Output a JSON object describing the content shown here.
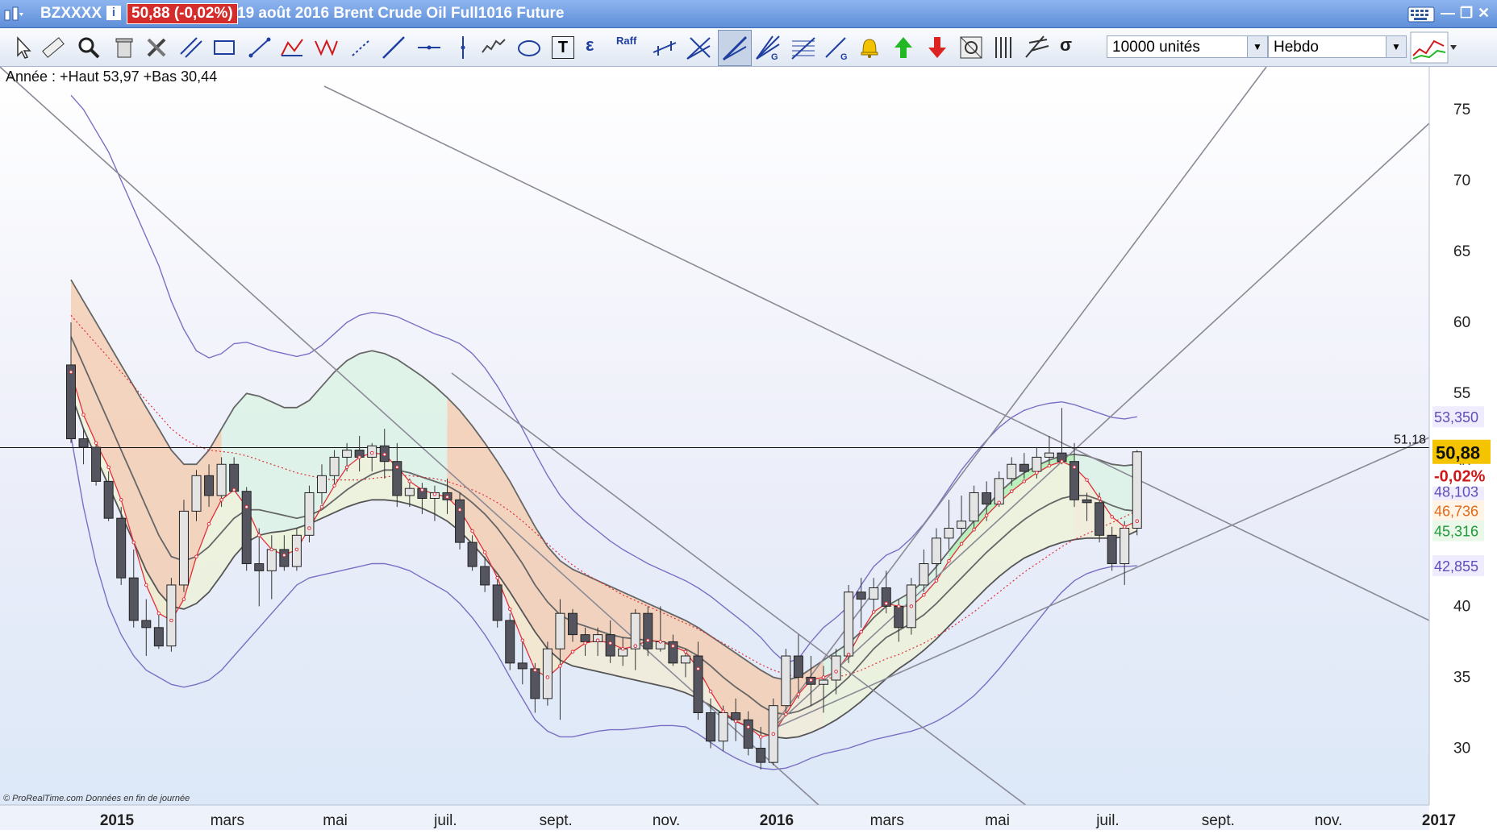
{
  "titlebar": {
    "symbol": "BZXXXX",
    "info": "i",
    "price_badge": "50,88 (-0,02%)",
    "description": "19 août 2016 Brent Crude Oil Full1016 Future"
  },
  "toolbar": {
    "quantity": "10000 unités",
    "period": "Hebdo",
    "tool_text": "T",
    "tool_epsilon": "ε",
    "tool_raff": "Raff",
    "tool_sigma": "σ",
    "tool_g": "G"
  },
  "chart_info": "Année : +Haut 53,97 +Bas 30,44",
  "copyright": "© ProRealTime.com  Données en fin de journée",
  "price_labels": {
    "hline_value": "51,18",
    "last_price": "50,88",
    "change_pct": "-0,02%",
    "bb_upper": "53,350",
    "bb_mid": "48,103",
    "ma_a": "46,736",
    "ma_b": "45,316",
    "bb_lower": "42,855"
  },
  "colors": {
    "bullish": "#e4e4e4",
    "bearish": "#555560",
    "ma_red": "#e0303a",
    "band_purple": "#7a6fc4",
    "last_price_bg": "#f5c400",
    "change_color": "#d01818"
  },
  "chart_data": {
    "type": "candlestick",
    "title": "19 août 2016 Brent Crude Oil Full1016 Future",
    "period": "Hebdo",
    "ylim": [
      26,
      78
    ],
    "yticks": [
      30,
      35,
      40,
      45,
      50,
      55,
      60,
      65,
      70,
      75
    ],
    "x_labels": [
      "2015",
      "mars",
      "mai",
      "juil.",
      "sept.",
      "nov.",
      "2016",
      "mars",
      "mai",
      "juil.",
      "sept.",
      "nov.",
      "2017"
    ],
    "x_label_positions": [
      0,
      8.8,
      17.4,
      26.2,
      35,
      43.8,
      52.6,
      61.4,
      70.2,
      79,
      87.8,
      96.6,
      105.4
    ],
    "horizontal_line": 51.18,
    "annual_high": 53.97,
    "annual_low": 30.44,
    "candles": [
      [
        57.0,
        60.0,
        51.5,
        51.8
      ],
      [
        51.8,
        52.5,
        50.0,
        51.2
      ],
      [
        51.2,
        51.5,
        48.5,
        48.8
      ],
      [
        48.8,
        49.5,
        46.0,
        46.2
      ],
      [
        46.2,
        47.0,
        41.5,
        42.0
      ],
      [
        42.0,
        44.0,
        38.5,
        39.0
      ],
      [
        39.0,
        40.5,
        36.5,
        38.5
      ],
      [
        38.5,
        39.5,
        37.0,
        37.2
      ],
      [
        37.2,
        42.0,
        36.8,
        41.5
      ],
      [
        41.5,
        47.5,
        41.0,
        46.7
      ],
      [
        46.7,
        49.6,
        46.0,
        49.2
      ],
      [
        49.2,
        50.0,
        47.0,
        47.8
      ],
      [
        47.8,
        50.5,
        47.0,
        50.0
      ],
      [
        50.0,
        50.5,
        48.5,
        48.1
      ],
      [
        48.1,
        48.4,
        42.5,
        43.0
      ],
      [
        43.0,
        45.5,
        40.0,
        42.5
      ],
      [
        42.5,
        45.0,
        40.5,
        44.0
      ],
      [
        44.0,
        45.0,
        42.5,
        42.8
      ],
      [
        42.8,
        45.5,
        42.5,
        45.0
      ],
      [
        45.0,
        48.5,
        44.5,
        48.0
      ],
      [
        48.0,
        50.0,
        47.2,
        49.2
      ],
      [
        49.2,
        51.0,
        48.5,
        50.5
      ],
      [
        50.5,
        51.5,
        49.5,
        51.0
      ],
      [
        51.0,
        52.0,
        49.5,
        50.5
      ],
      [
        50.5,
        51.5,
        49.5,
        51.3
      ],
      [
        51.3,
        52.5,
        49.0,
        50.2
      ],
      [
        50.2,
        51.5,
        47.0,
        47.8
      ],
      [
        47.8,
        49.0,
        47.0,
        48.3
      ],
      [
        48.3,
        48.7,
        46.5,
        47.6
      ],
      [
        47.6,
        48.5,
        46.0,
        48.0
      ],
      [
        48.0,
        49.0,
        46.5,
        47.5
      ],
      [
        47.5,
        48.0,
        44.0,
        44.5
      ],
      [
        44.5,
        45.0,
        42.5,
        42.8
      ],
      [
        42.8,
        43.5,
        41.0,
        41.5
      ],
      [
        41.5,
        42.0,
        38.5,
        39.0
      ],
      [
        39.0,
        39.5,
        35.5,
        36.0
      ],
      [
        36.0,
        37.5,
        34.5,
        35.6
      ],
      [
        35.6,
        36.0,
        32.5,
        33.5
      ],
      [
        33.5,
        37.5,
        33.0,
        37.0
      ],
      [
        37.0,
        40.5,
        32.0,
        39.5
      ],
      [
        39.5,
        39.8,
        37.5,
        38.0
      ],
      [
        38.0,
        38.5,
        36.5,
        37.5
      ],
      [
        37.5,
        38.5,
        36.5,
        38.0
      ],
      [
        38.0,
        39.0,
        36.0,
        36.5
      ],
      [
        36.5,
        37.8,
        35.8,
        37.0
      ],
      [
        37.0,
        39.8,
        35.5,
        39.5
      ],
      [
        39.5,
        40.0,
        36.5,
        37.0
      ],
      [
        37.0,
        40.0,
        36.8,
        37.5
      ],
      [
        37.5,
        38.0,
        35.8,
        36.0
      ],
      [
        36.0,
        37.0,
        35.0,
        36.5
      ],
      [
        36.5,
        37.5,
        32.0,
        32.5
      ],
      [
        32.5,
        33.5,
        30.0,
        30.5
      ],
      [
        30.5,
        33.0,
        29.8,
        32.5
      ],
      [
        32.5,
        33.5,
        30.5,
        32.0
      ],
      [
        32.0,
        32.6,
        29.5,
        30.0
      ],
      [
        30.0,
        31.5,
        28.5,
        29.0
      ],
      [
        29.0,
        33.5,
        28.8,
        33.0
      ],
      [
        33.0,
        37.0,
        32.5,
        36.5
      ],
      [
        36.5,
        38.0,
        33.5,
        35.0
      ],
      [
        35.0,
        36.5,
        33.0,
        34.5
      ],
      [
        34.5,
        35.8,
        32.5,
        34.8
      ],
      [
        34.8,
        37.0,
        33.8,
        36.5
      ],
      [
        36.5,
        41.5,
        36.0,
        41.0
      ],
      [
        41.0,
        42.0,
        38.5,
        40.5
      ],
      [
        40.5,
        42.0,
        39.5,
        41.3
      ],
      [
        41.3,
        42.5,
        39.5,
        40.0
      ],
      [
        40.0,
        40.5,
        37.5,
        38.5
      ],
      [
        38.5,
        42.0,
        38.0,
        41.5
      ],
      [
        41.5,
        44.0,
        41.0,
        43.0
      ],
      [
        43.0,
        45.5,
        42.0,
        44.8
      ],
      [
        44.8,
        47.5,
        44.0,
        45.5
      ],
      [
        45.5,
        47.8,
        45.0,
        46.0
      ],
      [
        46.0,
        48.5,
        45.5,
        48.0
      ],
      [
        48.0,
        48.8,
        46.0,
        47.2
      ],
      [
        47.2,
        49.5,
        47.0,
        49.0
      ],
      [
        49.0,
        50.5,
        48.5,
        50.0
      ],
      [
        50.0,
        50.8,
        49.0,
        49.5
      ],
      [
        49.5,
        51.2,
        49.0,
        50.5
      ],
      [
        50.5,
        52.0,
        50.0,
        50.8
      ],
      [
        50.8,
        53.97,
        50.0,
        50.2
      ],
      [
        50.2,
        51.5,
        47.0,
        47.5
      ],
      [
        47.5,
        48.0,
        46.0,
        47.3
      ],
      [
        47.3,
        48.0,
        44.5,
        45.0
      ],
      [
        45.0,
        45.6,
        42.5,
        43.0
      ],
      [
        43.0,
        46.0,
        41.5,
        45.5
      ],
      [
        45.5,
        51.0,
        45.0,
        50.88
      ]
    ],
    "series": [
      {
        "name": "MA fast",
        "values": [
          56.5,
          53.5,
          51.5,
          49.8,
          47.5,
          44.5,
          41.5,
          39.5,
          39.0,
          40.5,
          43.5,
          45.8,
          47.5,
          48.2,
          47.0,
          45.0,
          44.0,
          43.6,
          44.0,
          45.5,
          47.0,
          48.5,
          49.8,
          50.5,
          50.8,
          50.7,
          49.8,
          48.8,
          48.2,
          47.9,
          47.7,
          46.8,
          45.3,
          43.8,
          42.0,
          39.8,
          37.6,
          35.5,
          35.0,
          35.8,
          36.8,
          37.4,
          37.6,
          37.4,
          37.0,
          37.2,
          37.6,
          37.5,
          37.2,
          36.8,
          35.6,
          34.0,
          32.6,
          31.9,
          31.5,
          30.8,
          31.0,
          32.4,
          33.8,
          34.8,
          35.0,
          35.4,
          36.6,
          38.2,
          39.6,
          40.2,
          40.0,
          40.0,
          40.8,
          41.8,
          43.2,
          44.4,
          45.4,
          46.4,
          47.3,
          48.1,
          48.8,
          49.4,
          49.9,
          50.2,
          49.8,
          48.9,
          47.6,
          46.3,
          45.6,
          46.0
        ]
      },
      {
        "name": "MA mid",
        "values": [
          59.0,
          57.0,
          55.0,
          53.0,
          51.0,
          49.0,
          47.0,
          45.0,
          43.5,
          43.2,
          43.5,
          44.2,
          45.2,
          46.2,
          46.8,
          46.8,
          46.6,
          46.4,
          46.2,
          46.4,
          46.8,
          47.5,
          48.2,
          48.8,
          49.3,
          49.6,
          49.6,
          49.4,
          49.1,
          48.8,
          48.5,
          48.0,
          47.3,
          46.5,
          45.5,
          44.3,
          43.0,
          41.5,
          40.3,
          39.4,
          38.9,
          38.6,
          38.3,
          38.0,
          37.8,
          37.7,
          37.6,
          37.5,
          37.3,
          37.0,
          36.5,
          35.8,
          35.0,
          34.3,
          33.7,
          33.0,
          32.5,
          32.4,
          32.6,
          33.0,
          33.5,
          34.2,
          35.0,
          36.0,
          37.0,
          37.8,
          38.3,
          38.8,
          39.4,
          40.2,
          41.1,
          42.0,
          42.9,
          43.8,
          44.6,
          45.4,
          46.1,
          46.7,
          47.2,
          47.6,
          47.8,
          47.8,
          47.5,
          47.1,
          46.8,
          46.7
        ]
      },
      {
        "name": "Bollinger upper",
        "values": [
          76.0,
          75.0,
          73.5,
          72.0,
          70.0,
          68.0,
          66.0,
          64.0,
          61.5,
          59.5,
          58.0,
          57.5,
          57.8,
          58.5,
          58.6,
          58.3,
          58.0,
          57.8,
          57.6,
          57.8,
          58.4,
          59.2,
          60.0,
          60.5,
          60.7,
          60.6,
          60.4,
          60.0,
          59.6,
          59.2,
          58.9,
          58.5,
          57.8,
          56.8,
          55.5,
          54.0,
          52.5,
          50.8,
          49.2,
          47.8,
          46.8,
          46.0,
          45.3,
          44.6,
          44.0,
          43.5,
          43.0,
          42.6,
          42.2,
          41.8,
          41.3,
          40.7,
          40.0,
          39.3,
          38.6,
          37.8,
          36.8,
          36.0,
          36.3,
          37.5,
          38.5,
          39.2,
          40.0,
          41.5,
          42.8,
          43.6,
          44.0,
          44.8,
          45.8,
          47.0,
          48.3,
          49.6,
          50.7,
          51.7,
          52.6,
          53.3,
          53.8,
          54.1,
          54.3,
          54.4,
          54.2,
          53.9,
          53.6,
          53.3,
          53.2,
          53.35
        ]
      },
      {
        "name": "Bollinger lower",
        "values": [
          52.0,
          47.0,
          43.0,
          40.0,
          38.0,
          36.5,
          35.5,
          35.0,
          34.5,
          34.3,
          34.5,
          34.8,
          35.5,
          36.5,
          37.5,
          38.5,
          39.5,
          40.5,
          41.5,
          42.0,
          42.2,
          42.4,
          42.6,
          42.8,
          43.0,
          43.0,
          42.8,
          42.5,
          42.0,
          41.5,
          41.0,
          40.2,
          39.2,
          38.0,
          36.6,
          35.0,
          33.5,
          32.0,
          31.2,
          30.8,
          30.8,
          31.0,
          31.2,
          31.3,
          31.3,
          31.4,
          31.5,
          31.6,
          31.6,
          31.5,
          31.0,
          30.4,
          29.8,
          29.3,
          28.9,
          28.6,
          28.5,
          28.6,
          28.9,
          29.3,
          29.6,
          29.8,
          30.0,
          30.3,
          30.6,
          30.8,
          31.0,
          31.2,
          31.5,
          31.9,
          32.4,
          33.0,
          33.7,
          34.6,
          35.6,
          36.7,
          37.8,
          38.9,
          40.0,
          41.0,
          41.8,
          42.3,
          42.6,
          42.8,
          42.8,
          42.855
        ]
      },
      {
        "name": "Channel upper",
        "values": [
          63.0,
          61.5,
          60.0,
          58.5,
          57.0,
          55.5,
          54.0,
          52.5,
          51.0,
          50.0,
          50.0,
          51.0,
          52.5,
          54.0,
          55.0,
          54.8,
          54.4,
          54.0,
          54.0,
          54.5,
          55.5,
          56.5,
          57.3,
          57.8,
          58.0,
          57.8,
          57.4,
          56.8,
          56.2,
          55.5,
          54.7,
          53.8,
          52.7,
          51.5,
          50.2,
          48.8,
          47.2,
          45.6,
          44.2,
          43.2,
          42.6,
          42.2,
          41.8,
          41.4,
          41.0,
          40.6,
          40.2,
          39.8,
          39.4,
          39.0,
          38.5,
          37.9,
          37.3,
          36.7,
          36.1,
          35.5,
          35.0,
          34.8,
          35.0,
          35.6,
          36.2,
          36.8,
          37.4,
          38.2,
          39.2,
          40.0,
          40.5,
          41.0,
          41.8,
          42.8,
          43.9,
          45.0,
          46.0,
          47.0,
          48.0,
          48.8,
          49.4,
          49.9,
          50.3,
          50.6,
          50.7,
          50.6,
          50.3,
          50.0,
          49.9,
          50.0
        ]
      },
      {
        "name": "Channel lower",
        "values": [
          55.0,
          52.5,
          50.5,
          48.5,
          46.5,
          44.5,
          42.5,
          41.0,
          40.0,
          39.8,
          40.2,
          41.0,
          42.2,
          43.5,
          44.5,
          45.0,
          45.2,
          45.3,
          45.5,
          45.8,
          46.2,
          46.6,
          47.0,
          47.3,
          47.5,
          47.5,
          47.4,
          47.2,
          46.9,
          46.5,
          46.0,
          45.3,
          44.4,
          43.4,
          42.3,
          41.0,
          39.6,
          38.2,
          37.0,
          36.2,
          35.8,
          35.6,
          35.4,
          35.2,
          35.0,
          34.8,
          34.6,
          34.4,
          34.2,
          33.9,
          33.5,
          33.0,
          32.4,
          31.9,
          31.5,
          31.1,
          30.8,
          30.7,
          30.8,
          31.1,
          31.5,
          32.0,
          32.6,
          33.3,
          34.1,
          34.9,
          35.6,
          36.2,
          36.9,
          37.7,
          38.6,
          39.5,
          40.4,
          41.3,
          42.1,
          42.8,
          43.4,
          43.8,
          44.2,
          44.5,
          44.7,
          44.8,
          44.8,
          44.8,
          44.9,
          45.316
        ]
      },
      {
        "name": "MA dotted",
        "values": [
          60.5,
          59.5,
          58.5,
          57.5,
          56.5,
          55.5,
          54.5,
          53.5,
          52.5,
          51.8,
          51.3,
          51.0,
          50.9,
          50.8,
          50.6,
          50.3,
          50.0,
          49.7,
          49.4,
          49.2,
          49.0,
          48.9,
          48.9,
          48.9,
          49.0,
          49.1,
          49.2,
          49.2,
          49.1,
          49.0,
          48.8,
          48.5,
          48.2,
          47.8,
          47.3,
          46.7,
          46.0,
          45.2,
          44.4,
          43.6,
          42.9,
          42.3,
          41.8,
          41.3,
          40.8,
          40.4,
          40.0,
          39.6,
          39.2,
          38.8,
          38.4,
          37.9,
          37.4,
          36.9,
          36.4,
          35.9,
          35.5,
          35.2,
          35.0,
          34.9,
          34.9,
          35.0,
          35.2,
          35.5,
          35.9,
          36.3,
          36.6,
          37.0,
          37.4,
          37.9,
          38.4,
          39.0,
          39.6,
          40.3,
          41.0,
          41.7,
          42.4,
          43.0,
          43.6,
          44.2,
          44.7,
          45.1,
          45.5,
          45.9,
          46.3,
          46.736
        ]
      }
    ]
  }
}
